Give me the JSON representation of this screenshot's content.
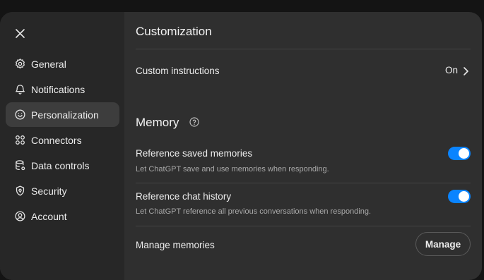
{
  "sidebar": {
    "close_icon": "close-icon",
    "items": [
      {
        "label": "General",
        "icon": "gear-icon"
      },
      {
        "label": "Notifications",
        "icon": "bell-icon"
      },
      {
        "label": "Personalization",
        "icon": "personalization-icon",
        "active": true
      },
      {
        "label": "Connectors",
        "icon": "connectors-icon"
      },
      {
        "label": "Data controls",
        "icon": "database-icon"
      },
      {
        "label": "Security",
        "icon": "shield-icon"
      },
      {
        "label": "Account",
        "icon": "user-circle-icon"
      }
    ]
  },
  "main": {
    "customization_title": "Customization",
    "custom_instructions": {
      "label": "Custom instructions",
      "value": "On"
    },
    "memory_title": "Memory",
    "reference_saved": {
      "label": "Reference saved memories",
      "description": "Let ChatGPT save and use memories when responding.",
      "enabled": true
    },
    "reference_history": {
      "label": "Reference chat history",
      "description": "Let ChatGPT reference all previous conversations when responding.",
      "enabled": true
    },
    "manage_memories": {
      "label": "Manage memories",
      "button": "Manage"
    }
  },
  "colors": {
    "background": "#2f2f2f",
    "sidebar": "#272727",
    "toggle_on": "#0a84ff",
    "active_item": "#3d3d3d"
  }
}
